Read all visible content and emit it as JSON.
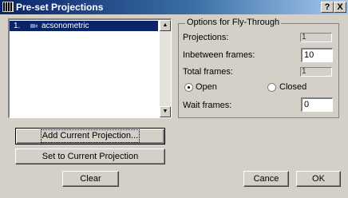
{
  "window": {
    "title": "Pre-set Projections",
    "help_label": "?",
    "close_label": "X"
  },
  "list": {
    "items": [
      {
        "number": "1.",
        "name": "acsonometric",
        "selected": true
      }
    ]
  },
  "options": {
    "group_title": "Options for Fly-Through",
    "projections_label": "Projections:",
    "projections_value": "1",
    "inbetween_label": "Inbetween frames:",
    "inbetween_value": "10",
    "total_label": "Total frames:",
    "total_value": "1",
    "open_label": "Open",
    "closed_label": "Closed",
    "selected_mode": "open",
    "wait_label": "Wait frames:",
    "wait_value": "0"
  },
  "buttons": {
    "add_current": "Add Current Projection...",
    "set_current": "Set to Current Projection",
    "clear": "Clear",
    "cancel": "Cance",
    "ok": "OK"
  },
  "colors": {
    "selection": "#0a246a",
    "face": "#d4d0c8"
  }
}
